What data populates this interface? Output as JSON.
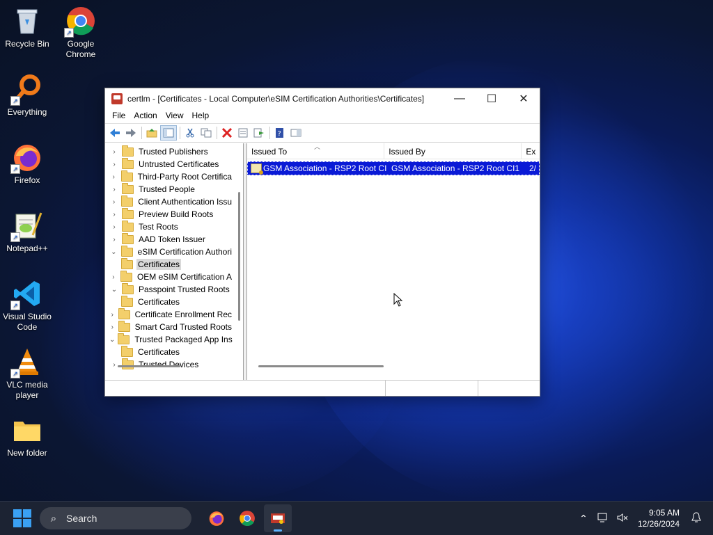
{
  "desktop": {
    "icons": [
      {
        "label": "Recycle Bin"
      },
      {
        "label": "Google Chrome"
      },
      {
        "label": "Everything"
      },
      {
        "label": "Firefox"
      },
      {
        "label": "Notepad++"
      },
      {
        "label": "Visual Studio Code"
      },
      {
        "label": "VLC media player"
      },
      {
        "label": "New folder"
      }
    ]
  },
  "window": {
    "title": "certlm - [Certificates - Local Computer\\eSIM Certification Authorities\\Certificates]",
    "controls": {
      "minimize": "—",
      "maximize": "☐",
      "close": "✕"
    },
    "menu": [
      "File",
      "Action",
      "View",
      "Help"
    ],
    "tree": [
      {
        "label": "Trusted Publishers",
        "caret": "›"
      },
      {
        "label": "Untrusted Certificates",
        "caret": "›"
      },
      {
        "label": "Third-Party Root Certifica",
        "caret": "›"
      },
      {
        "label": "Trusted People",
        "caret": "›"
      },
      {
        "label": "Client Authentication Issu",
        "caret": "›"
      },
      {
        "label": "Preview Build Roots",
        "caret": "›"
      },
      {
        "label": "Test Roots",
        "caret": "›"
      },
      {
        "label": "AAD Token Issuer",
        "caret": "›"
      },
      {
        "label": "eSIM Certification Authori",
        "caret": "⌄"
      },
      {
        "label": "Certificates",
        "caret": ""
      },
      {
        "label": "OEM eSIM Certification A",
        "caret": "›"
      },
      {
        "label": "Passpoint Trusted Roots",
        "caret": "⌄"
      },
      {
        "label": "Certificates",
        "caret": ""
      },
      {
        "label": "Certificate Enrollment Rec",
        "caret": "›"
      },
      {
        "label": "Smart Card Trusted Roots",
        "caret": "›"
      },
      {
        "label": "Trusted Packaged App Ins",
        "caret": "⌄"
      },
      {
        "label": "Certificates",
        "caret": ""
      },
      {
        "label": "Trusted Devices",
        "caret": "›"
      }
    ],
    "list": {
      "columns": [
        "Issued To",
        "Issued By",
        "Ex"
      ],
      "rows": [
        {
          "issued_to": "GSM Association - RSP2 Root CI1",
          "issued_by": "GSM Association - RSP2 Root CI1",
          "expiration": "2/"
        }
      ]
    }
  },
  "taskbar": {
    "search_placeholder": "Search",
    "time": "9:05 AM",
    "date": "12/26/2024"
  },
  "colors": {
    "selection": "#0a1ad6",
    "taskbar": "#1c2333",
    "accent": "#3aa0f3"
  }
}
